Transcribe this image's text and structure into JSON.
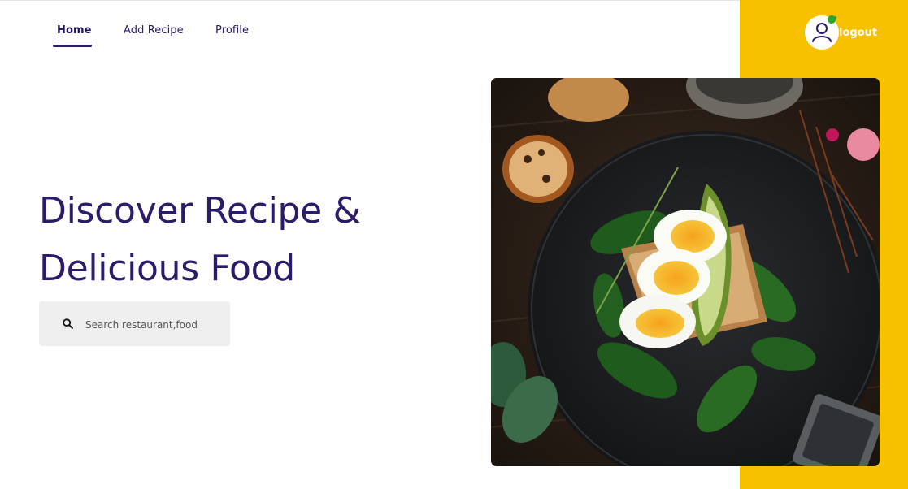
{
  "nav": {
    "items": [
      {
        "label": "Home",
        "active": true
      },
      {
        "label": "Add Recipe",
        "active": false
      },
      {
        "label": "Profile",
        "active": false
      }
    ]
  },
  "header": {
    "logout_label": "logout",
    "avatar_icon": "user-icon",
    "accent_color": "#f8c100"
  },
  "hero": {
    "title_line1": "Discover Recipe &",
    "title_line2": "Delicious Food",
    "title_color": "#2c1a6b"
  },
  "search": {
    "placeholder": "Search restaurant,food",
    "value": "",
    "icon": "search-icon"
  },
  "image": {
    "alt": "Toast with boiled eggs, avocado and spinach on a dark plate"
  }
}
